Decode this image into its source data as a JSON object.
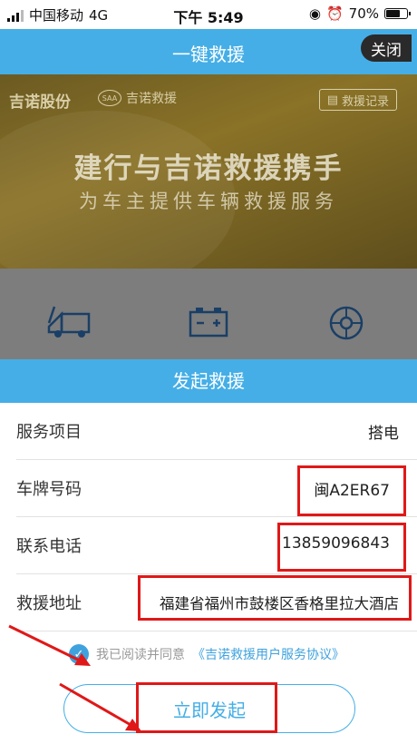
{
  "status_bar": {
    "carrier": "中国移动",
    "network": "4G",
    "time": "下午 5:49",
    "battery": "70%",
    "battery_level": 0.7
  },
  "nav": {
    "title": "一键救援",
    "close_label": "关闭"
  },
  "banner": {
    "logo_primary": "吉诺股份",
    "logo_secondary": "吉诺救援",
    "logo_badge": "SAA",
    "record_label": "救援记录",
    "headline": "建行与吉诺救援携手",
    "subheadline": "为车主提供车辆救援服务"
  },
  "services": [
    {
      "label": "拖车",
      "icon": "tow-truck-icon"
    },
    {
      "label": "搭电",
      "icon": "battery-icon"
    },
    {
      "label": "换胎",
      "icon": "tire-icon"
    }
  ],
  "sheet": {
    "title": "发起救援",
    "fields": [
      {
        "label": "服务项目",
        "value": "搭电"
      },
      {
        "label": "车牌号码",
        "value": "闽A2ER67"
      },
      {
        "label": "联系电话",
        "value": "13859096843"
      },
      {
        "label": "救援地址",
        "value": "福建省福州市鼓楼区香格里拉大酒店"
      }
    ],
    "agreement_prefix": "我已阅读并同意",
    "agreement_link": "《吉诺救援用户服务协议》",
    "agreement_checked": true,
    "submit_label": "立即发起"
  },
  "colors": {
    "accent": "#45aee6",
    "highlight": "#e01818"
  }
}
